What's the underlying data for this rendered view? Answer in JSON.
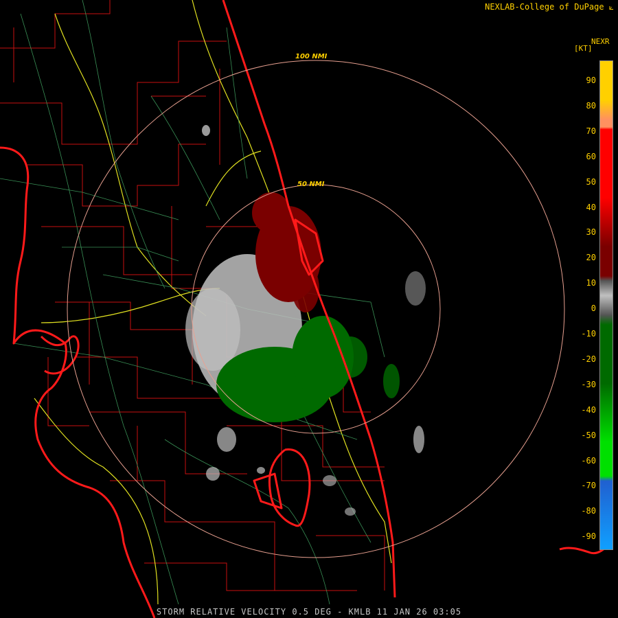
{
  "header": {
    "credit": "NEXLAB-College of DuPage"
  },
  "legend": {
    "product": "NEXR",
    "units": "[KT]",
    "ticks": [
      "90",
      "80",
      "70",
      "60",
      "50",
      "40",
      "30",
      "20",
      "10",
      "0",
      "-10",
      "-20",
      "-30",
      "-40",
      "-50",
      "-60",
      "-70",
      "-80",
      "-90"
    ],
    "colors": {
      "pos_high": "#ffd000",
      "pos_orange": "#ff9060",
      "pos_red": "#ff0000",
      "pos_dark": "#7a0000",
      "zero": "#c0c0c0",
      "neg_dark": "#006a00",
      "neg_bright": "#00e000",
      "neg_blue": "#2060d0",
      "neg_cyan": "#10a0ff"
    }
  },
  "range_rings": [
    {
      "label": "100 NMI"
    },
    {
      "label": "50 NMI"
    }
  ],
  "footer": {
    "caption": "STORM RELATIVE VELOCITY 0.5 DEG - KMLB 11 JAN 26 03:05"
  }
}
